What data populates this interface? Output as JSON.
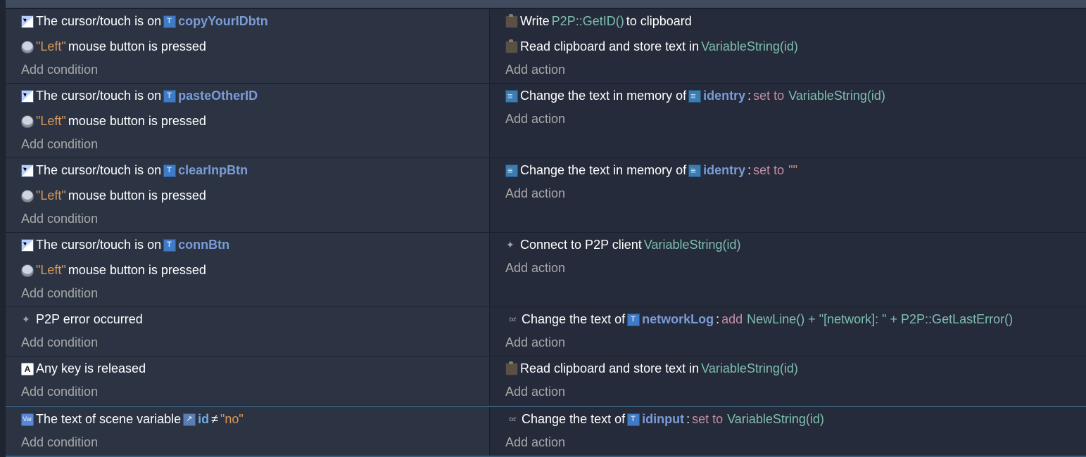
{
  "topFragment": {
    "addAction": "Add action"
  },
  "strings": {
    "cursorOn": "The cursor/touch is on",
    "leftQuoted": "\"Left\"",
    "mousePressed": "mouse button is pressed",
    "addCondition": "Add condition",
    "addAction": "Add action",
    "write": "Write",
    "toClipboard": "to clipboard",
    "readClipboard": "Read clipboard and store text in",
    "changeTextMem": "Change the text in memory of",
    "changeTextOf": "Change the text of",
    "connectTo": "Connect to P2P client",
    "setTo": "set to",
    "add": "add",
    "p2pError": "P2P error occurred",
    "anyKeyReleased": "Any key is released",
    "sceneVarText": "The text of scene variable",
    "neq": "≠",
    "noQuoted": "\"no\"",
    "colon": ":",
    "emptyQuoted": "\"\""
  },
  "objects": {
    "copyYourIDbtn": "copyYourIDbtn",
    "pasteOtherID": "pasteOtherID",
    "clearInpBtn": "clearInpBtn",
    "connBtn": "connBtn",
    "identry": "identry",
    "networkLog": "networkLog",
    "idinput": "idinput",
    "idVar": "id"
  },
  "exprs": {
    "p2pGetID": "P2P::GetID()",
    "variableStringId": "VariableString(id)",
    "networkLogExpr": "NewLine() + \"[network]: \" + P2P::GetLastError()"
  },
  "events": [
    {
      "conditions": [
        {
          "kind": "cursor",
          "object": "copyYourIDbtn"
        },
        {
          "kind": "mouse"
        }
      ],
      "actions": [
        {
          "kind": "write",
          "expr": "p2pGetID"
        },
        {
          "kind": "readClipboard",
          "var": "variableStringId"
        }
      ]
    },
    {
      "conditions": [
        {
          "kind": "cursor",
          "object": "pasteOtherID"
        },
        {
          "kind": "mouse"
        }
      ],
      "actions": [
        {
          "kind": "changeMem",
          "object": "identry",
          "op": "setTo",
          "valueVar": "variableStringId"
        }
      ]
    },
    {
      "conditions": [
        {
          "kind": "cursor",
          "object": "clearInpBtn"
        },
        {
          "kind": "mouse"
        }
      ],
      "actions": [
        {
          "kind": "changeMem",
          "object": "identry",
          "op": "setTo",
          "valueString": "emptyQuoted"
        }
      ]
    },
    {
      "conditions": [
        {
          "kind": "cursor",
          "object": "connBtn"
        },
        {
          "kind": "mouse"
        }
      ],
      "actions": [
        {
          "kind": "connect",
          "var": "variableStringId"
        }
      ]
    },
    {
      "conditions": [
        {
          "kind": "p2perror"
        }
      ],
      "actions": [
        {
          "kind": "changeText",
          "object": "networkLog",
          "op": "add",
          "valueVar": "networkLogExpr"
        }
      ]
    },
    {
      "conditions": [
        {
          "kind": "anykey"
        }
      ],
      "actions": [
        {
          "kind": "readClipboard",
          "var": "variableStringId"
        }
      ]
    },
    {
      "highlighted": true,
      "conditions": [
        {
          "kind": "sceneVar",
          "varObj": "idVar",
          "cmpString": "noQuoted"
        }
      ],
      "actions": [
        {
          "kind": "changeText",
          "object": "idinput",
          "op": "setTo",
          "valueVar": "variableStringId"
        }
      ]
    }
  ]
}
